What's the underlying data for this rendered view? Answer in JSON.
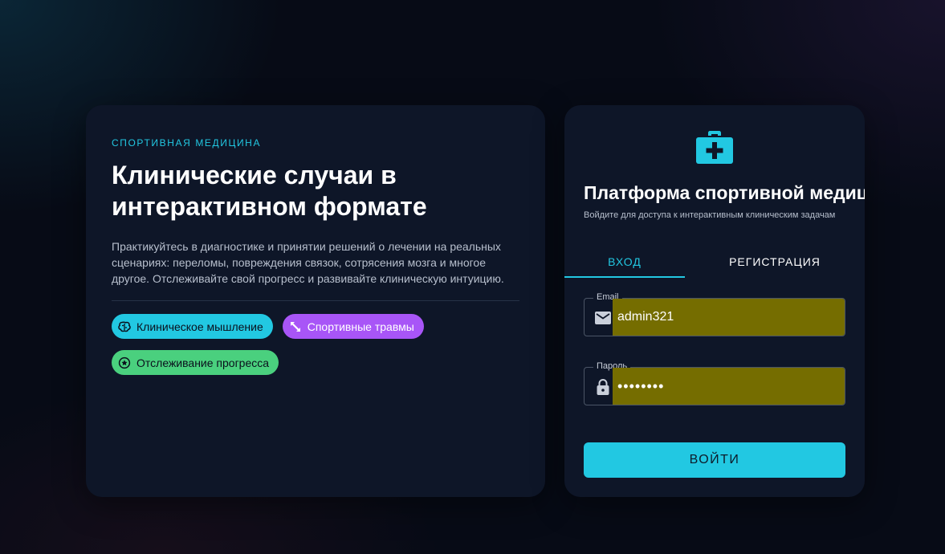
{
  "info": {
    "eyebrow": "СПОРТИВНАЯ МЕДИЦИНА",
    "headline": "Клинические случаи в интерактивном формате",
    "lead": "Практикуйтесь в диагностике и принятии решений о лечении на реальных сценариях: переломы, повреждения связок, сотрясения мозга и многое другое. Отслеживайте свой прогресс и развивайте клиническую интуицию.",
    "chips": [
      {
        "label": "Клиническое мышление",
        "icon": "brain-icon",
        "color": "#22c8e2"
      },
      {
        "label": "Спортивные травмы",
        "icon": "expand-arrows-icon",
        "color": "#a855f7"
      },
      {
        "label": "Отслеживание прогресса",
        "icon": "star-badge-icon",
        "color": "#4ad07e"
      }
    ]
  },
  "auth": {
    "icon": "medical-kit-icon",
    "title": "Платформа спортивной медицины",
    "subtitle": "Войдите для доступа к интерактивным клиническим задачам",
    "tabs": [
      {
        "label": "ВХОД",
        "active": true
      },
      {
        "label": "РЕГИСТРАЦИЯ",
        "active": false
      }
    ],
    "email": {
      "label": "Email",
      "value": "admin321",
      "icon": "mail-icon"
    },
    "password": {
      "label": "Пароль",
      "value": "secretpw",
      "icon": "lock-icon"
    },
    "submit_label": "ВОЙТИ"
  },
  "colors": {
    "accent": "#22c8e2",
    "card": "#0e1628",
    "autofill": "#756d00",
    "purple": "#a855f7",
    "green": "#4ad07e"
  }
}
